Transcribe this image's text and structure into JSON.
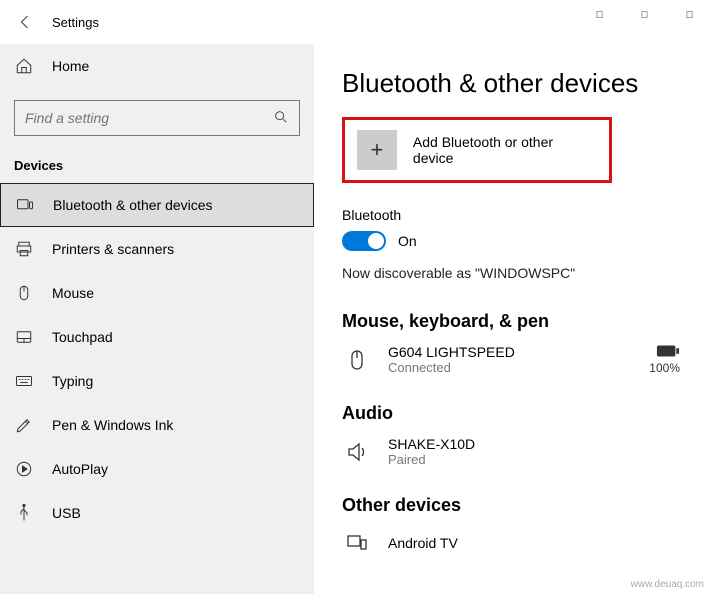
{
  "app_title": "Settings",
  "search": {
    "placeholder": "Find a setting"
  },
  "sidebar": {
    "home": "Home",
    "category": "Devices",
    "items": [
      {
        "label": "Bluetooth & other devices"
      },
      {
        "label": "Printers & scanners"
      },
      {
        "label": "Mouse"
      },
      {
        "label": "Touchpad"
      },
      {
        "label": "Typing"
      },
      {
        "label": "Pen & Windows Ink"
      },
      {
        "label": "AutoPlay"
      },
      {
        "label": "USB"
      }
    ]
  },
  "main": {
    "title": "Bluetooth & other devices",
    "add_device_label": "Add Bluetooth or other device",
    "bt_label": "Bluetooth",
    "bt_toggle_state": "On",
    "discoverable_text": "Now discoverable as \"WINDOWSPC\"",
    "groups": {
      "mouse_kb_pen": {
        "title": "Mouse, keyboard, & pen",
        "device": {
          "name": "G604 LIGHTSPEED",
          "status": "Connected",
          "battery_pct": "100%"
        }
      },
      "audio": {
        "title": "Audio",
        "device": {
          "name": "SHAKE-X10D",
          "status": "Paired"
        }
      },
      "other": {
        "title": "Other devices",
        "device": {
          "name": "Android TV"
        }
      }
    }
  },
  "watermark": "www.deuaq.com"
}
